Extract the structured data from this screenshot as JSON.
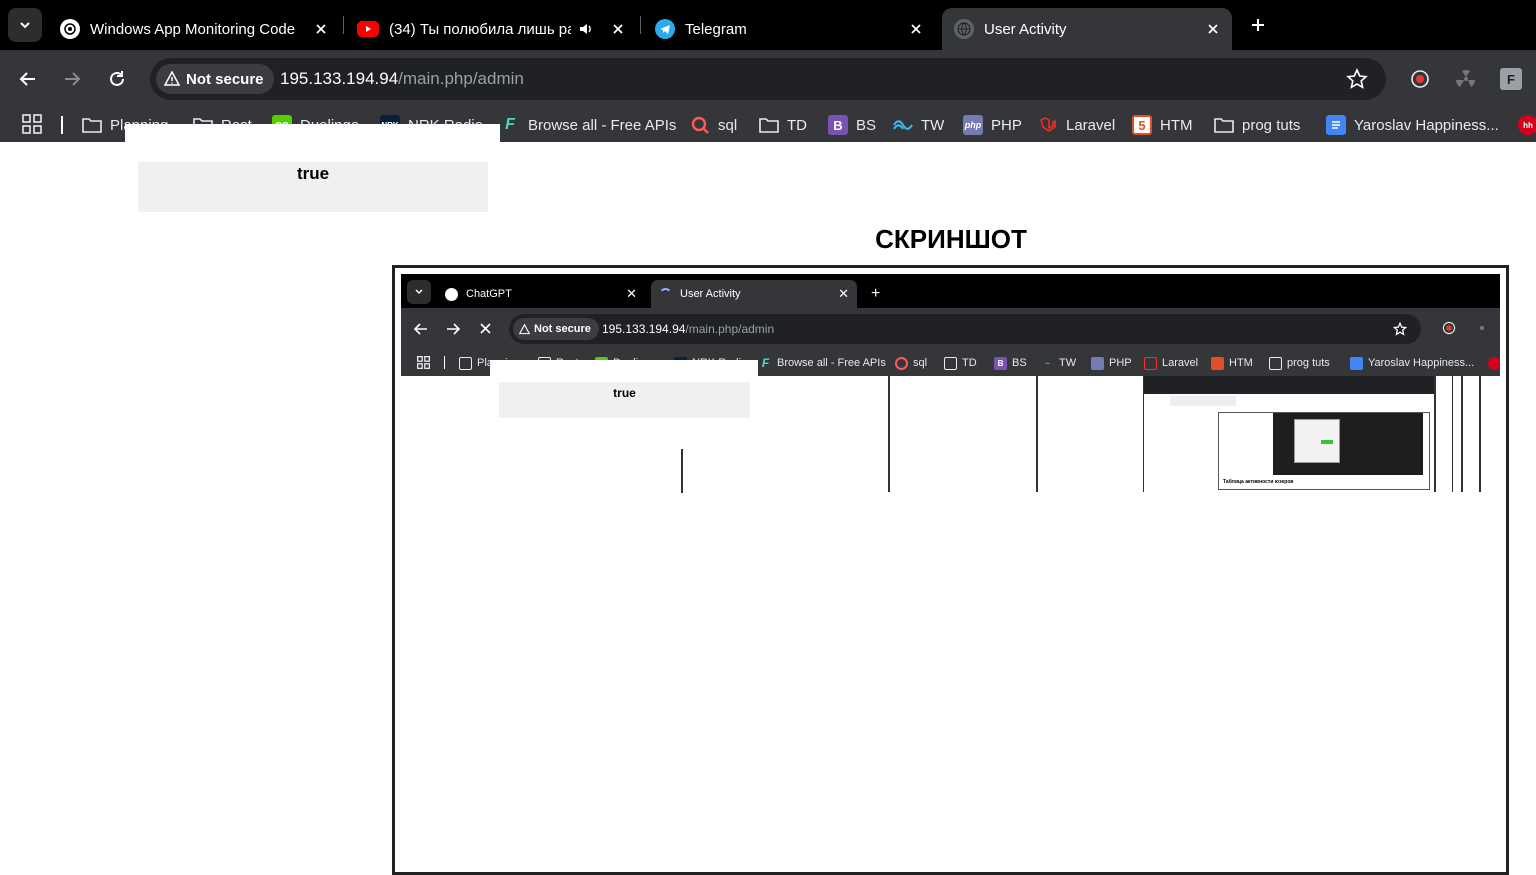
{
  "browser": {
    "tabs": [
      {
        "title": "Windows App Monitoring Code",
        "icon": "chatgpt-icon",
        "active": false
      },
      {
        "title": "(34) Ты полюбила лишь ра",
        "icon": "youtube-icon",
        "active": false,
        "audio": true
      },
      {
        "title": "Telegram",
        "icon": "telegram-icon",
        "active": false
      },
      {
        "title": "User Activity",
        "icon": "globe-icon",
        "active": true
      }
    ],
    "security_label": "Not secure",
    "url_host": "195.133.194.94",
    "url_path": "/main.php/admin",
    "profile_letter": "F",
    "bookmarks": [
      {
        "label": "Planning",
        "icon": "folder-icon"
      },
      {
        "label": "Rest",
        "icon": "folder-icon"
      },
      {
        "label": "Duolingo",
        "icon": "duolingo-icon"
      },
      {
        "label": "NRK Radio",
        "icon": "nrk-icon"
      },
      {
        "label": "Browse all - Free APIs",
        "icon": "freeapis-icon"
      },
      {
        "label": "sql",
        "icon": "search-icon"
      },
      {
        "label": "TD",
        "icon": "folder-icon"
      },
      {
        "label": "BS",
        "icon": "bootstrap-icon"
      },
      {
        "label": "TW",
        "icon": "tailwind-icon"
      },
      {
        "label": "PHP",
        "icon": "php-icon"
      },
      {
        "label": "Laravel",
        "icon": "laravel-icon"
      },
      {
        "label": "HTM",
        "icon": "html5-icon"
      },
      {
        "label": "prog tuts",
        "icon": "folder-icon"
      },
      {
        "label": "Yaroslav Happiness...",
        "icon": "docs-icon"
      }
    ]
  },
  "page": {
    "status_value": "true",
    "screenshot_heading": "СКРИНШОТ"
  },
  "inner_screenshot": {
    "tabs": [
      {
        "title": "ChatGPT",
        "icon": "chatgpt-icon",
        "active": false
      },
      {
        "title": "User Activity",
        "icon": "loading-icon",
        "active": true
      }
    ],
    "security_label": "Not secure",
    "url_host": "195.133.194.94",
    "url_path": "/main.php/admin",
    "bookmarks": [
      {
        "label": "Planning"
      },
      {
        "label": "Rest"
      },
      {
        "label": "Duolingo"
      },
      {
        "label": "NRK Radio"
      },
      {
        "label": "Browse all - Free APIs"
      },
      {
        "label": "sql"
      },
      {
        "label": "TD"
      },
      {
        "label": "BS"
      },
      {
        "label": "TW"
      },
      {
        "label": "PHP"
      },
      {
        "label": "Laravel"
      },
      {
        "label": "HTM"
      },
      {
        "label": "prog tuts"
      },
      {
        "label": "Yaroslav Happiness..."
      }
    ],
    "status_value": "true",
    "nested_caption": "Таблица активности юзеров"
  },
  "colors": {
    "chrome_dark": "#000000",
    "toolbar": "#35363a",
    "omnibox": "#202124",
    "status_box": "#f0f0f0"
  }
}
